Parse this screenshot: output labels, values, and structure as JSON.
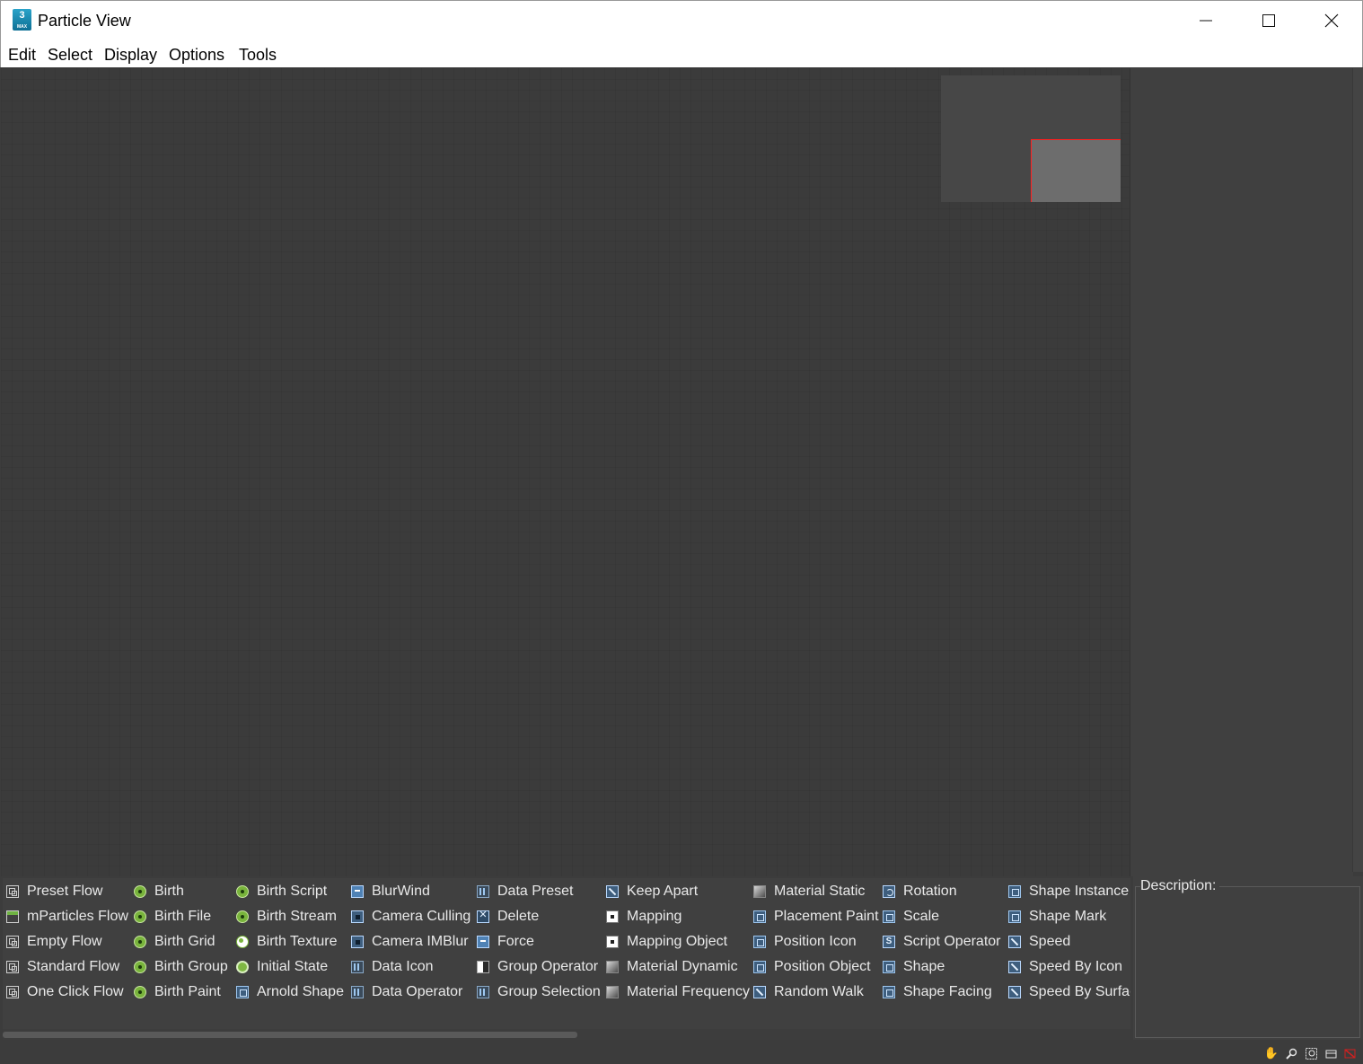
{
  "window": {
    "title": "Particle View",
    "app_icon_text": "3",
    "app_icon_subtext": "MAX"
  },
  "menu": [
    "Edit",
    "Select",
    "Display",
    "Options",
    "Tools"
  ],
  "depot": {
    "columns": [
      [
        {
          "label": "Preset Flow",
          "icon": "flow-icon"
        },
        {
          "label": "mParticles Flow",
          "icon": "mparticles-flow-icon"
        },
        {
          "label": "Empty Flow",
          "icon": "flow-icon"
        },
        {
          "label": "Standard Flow",
          "icon": "flow-icon"
        },
        {
          "label": "One Click Flow",
          "icon": "flow-icon"
        }
      ],
      [
        {
          "label": "Birth",
          "icon": "birth-icon"
        },
        {
          "label": "Birth File",
          "icon": "birth-icon"
        },
        {
          "label": "Birth Grid",
          "icon": "birth-icon"
        },
        {
          "label": "Birth Group",
          "icon": "birth-icon"
        },
        {
          "label": "Birth Paint",
          "icon": "birth-icon"
        }
      ],
      [
        {
          "label": "Birth Script",
          "icon": "birth-icon"
        },
        {
          "label": "Birth Stream",
          "icon": "birth-icon"
        },
        {
          "label": "Birth Texture",
          "icon": "birth-texture-icon"
        },
        {
          "label": "Initial State",
          "icon": "initial-state-icon"
        },
        {
          "label": "Arnold Shape",
          "icon": "operator-icon"
        }
      ],
      [
        {
          "label": "BlurWind",
          "icon": "force-icon"
        },
        {
          "label": "Camera Culling",
          "icon": "camera-icon"
        },
        {
          "label": "Camera IMBlur",
          "icon": "camera-icon"
        },
        {
          "label": "Data Icon",
          "icon": "data-icon"
        },
        {
          "label": "Data Operator",
          "icon": "data-icon"
        }
      ],
      [
        {
          "label": "Data Preset",
          "icon": "data-icon"
        },
        {
          "label": "Delete",
          "icon": "delete-icon"
        },
        {
          "label": "Force",
          "icon": "force-icon"
        },
        {
          "label": "Group Operator",
          "icon": "group-icon"
        },
        {
          "label": "Group Selection",
          "icon": "data-icon"
        }
      ],
      [
        {
          "label": "Keep Apart",
          "icon": "keep-apart-icon"
        },
        {
          "label": "Mapping",
          "icon": "mapping-icon"
        },
        {
          "label": "Mapping Object",
          "icon": "mapping-icon"
        },
        {
          "label": "Material Dynamic",
          "icon": "material-icon"
        },
        {
          "label": "Material Frequency",
          "icon": "material-icon"
        }
      ],
      [
        {
          "label": "Material Static",
          "icon": "material-icon"
        },
        {
          "label": "Placement Paint",
          "icon": "operator-icon"
        },
        {
          "label": "Position Icon",
          "icon": "operator-icon"
        },
        {
          "label": "Position Object",
          "icon": "operator-icon"
        },
        {
          "label": "Random Walk",
          "icon": "keep-apart-icon"
        }
      ],
      [
        {
          "label": "Rotation",
          "icon": "rotation-icon"
        },
        {
          "label": "Scale",
          "icon": "operator-icon"
        },
        {
          "label": "Script Operator",
          "icon": "script-icon"
        },
        {
          "label": "Shape",
          "icon": "operator-icon"
        },
        {
          "label": "Shape Facing",
          "icon": "operator-icon"
        }
      ],
      [
        {
          "label": "Shape Instance",
          "icon": "operator-icon"
        },
        {
          "label": "Shape Mark",
          "icon": "operator-icon"
        },
        {
          "label": "Speed",
          "icon": "keep-apart-icon"
        },
        {
          "label": "Speed By Icon",
          "icon": "keep-apart-icon"
        },
        {
          "label": "Speed By Surfac",
          "icon": "keep-apart-icon"
        }
      ]
    ]
  },
  "description": {
    "label": "Description:"
  },
  "status_icons": [
    "pan-icon",
    "zoom-icon",
    "zoom-region-icon",
    "zoom-extents-icon",
    "no-zoom-icon"
  ],
  "colors": {
    "navigator_view_border": "#ff1f1f",
    "birth_green": "#79b43c",
    "operator_blue": "#3e5e7e"
  }
}
